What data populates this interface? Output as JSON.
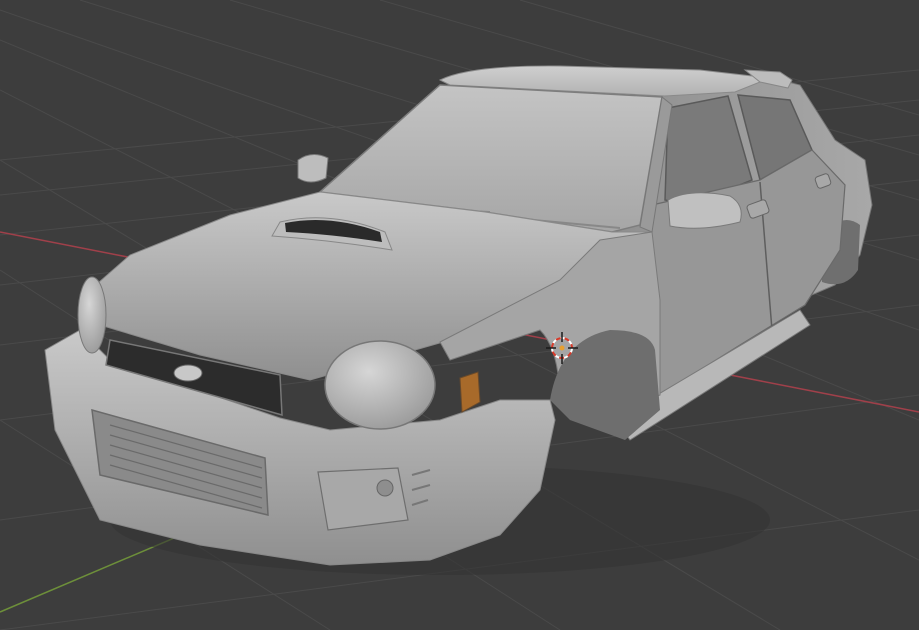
{
  "viewport": {
    "background": "#3d3d3d",
    "grid_line_color": "#4a4a4a",
    "x_axis_color": "#a0404a",
    "y_axis_color": "#6d8f3a",
    "cursor_icon": "3d-cursor-icon",
    "cursor_colors": [
      "#d83a2a",
      "#ffffff"
    ],
    "object_color": "#b0b0b0"
  }
}
